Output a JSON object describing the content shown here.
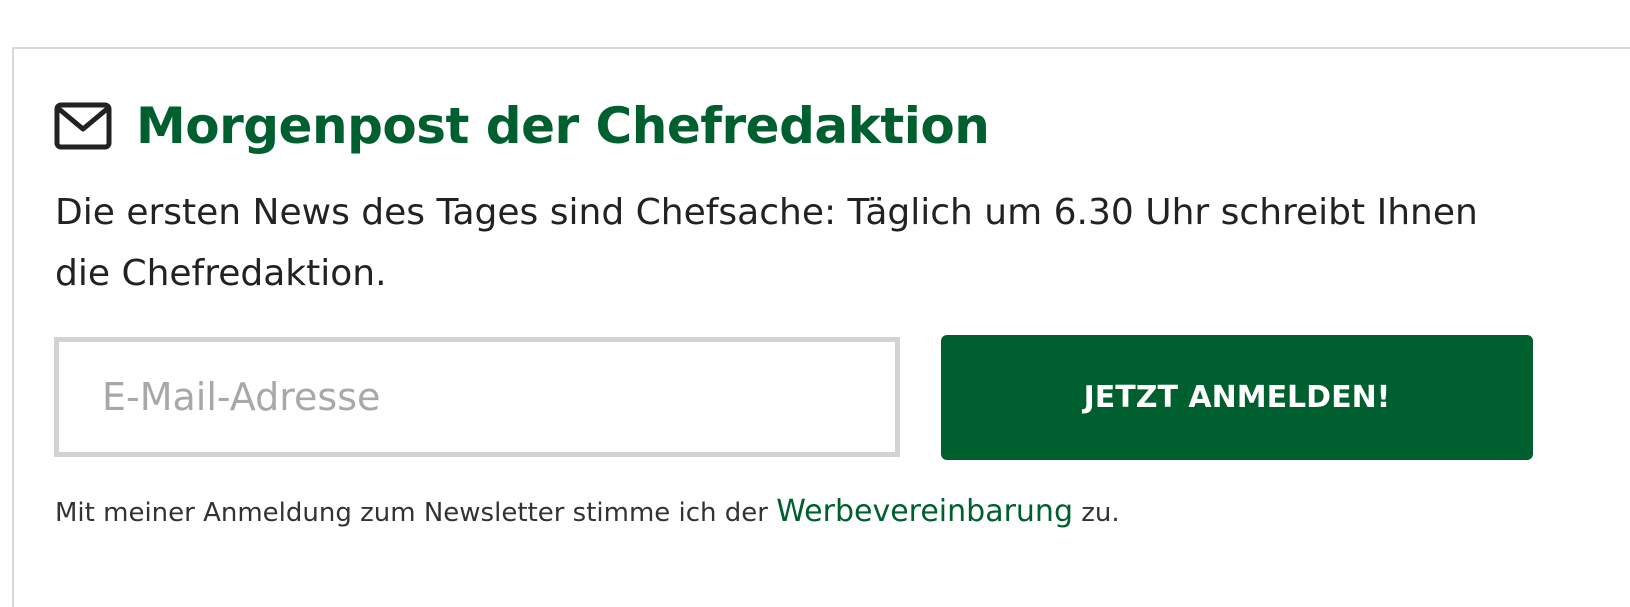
{
  "newsletter": {
    "icon": "mail-icon",
    "title": "Morgenpost der Chefredaktion",
    "description": "Die ersten News des Tages sind Chefsache: Täglich um 6.30 Uhr schreibt Ihnen die Chefredaktion.",
    "email_input": {
      "value": "",
      "placeholder": "E-Mail-Adresse"
    },
    "submit_label": "JETZT ANMELDEN!",
    "consent": {
      "prefix": "Mit meiner Anmeldung zum Newsletter stimme ich der ",
      "link_label": "Werbevereinbarung",
      "suffix": " zu."
    }
  },
  "colors": {
    "brand_green": "#005f2e",
    "text": "#222222",
    "input_border": "#d3d3d3",
    "placeholder": "#a8a8a8"
  }
}
